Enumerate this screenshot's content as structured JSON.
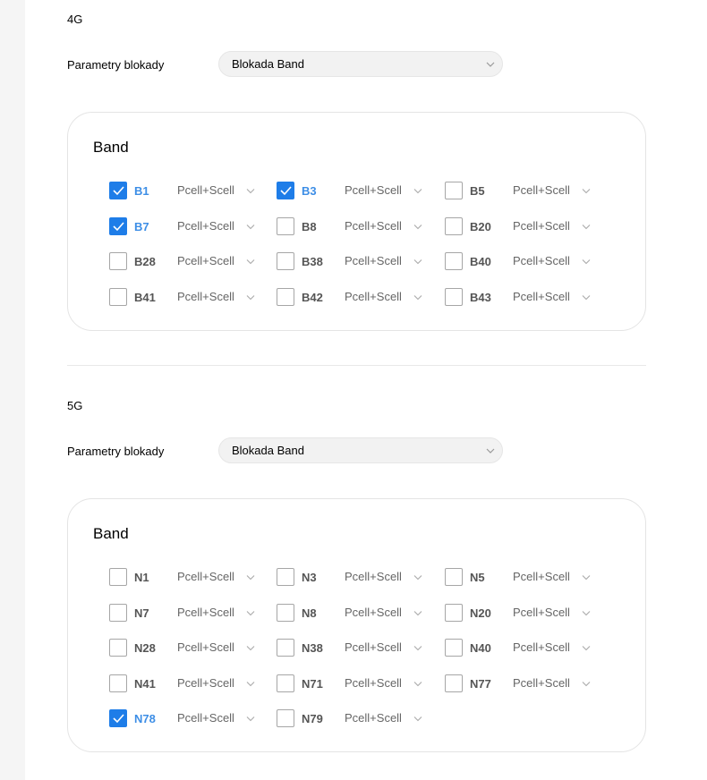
{
  "lte": {
    "section_label": "4G",
    "param_label": "Parametry blokady",
    "select_value": "Blokada Band",
    "card_title": "Band",
    "bands": [
      {
        "name": "B1",
        "mode": "Pcell+Scell",
        "checked": true
      },
      {
        "name": "B3",
        "mode": "Pcell+Scell",
        "checked": true
      },
      {
        "name": "B5",
        "mode": "Pcell+Scell",
        "checked": false
      },
      {
        "name": "B7",
        "mode": "Pcell+Scell",
        "checked": true
      },
      {
        "name": "B8",
        "mode": "Pcell+Scell",
        "checked": false
      },
      {
        "name": "B20",
        "mode": "Pcell+Scell",
        "checked": false
      },
      {
        "name": "B28",
        "mode": "Pcell+Scell",
        "checked": false
      },
      {
        "name": "B38",
        "mode": "Pcell+Scell",
        "checked": false
      },
      {
        "name": "B40",
        "mode": "Pcell+Scell",
        "checked": false
      },
      {
        "name": "B41",
        "mode": "Pcell+Scell",
        "checked": false
      },
      {
        "name": "B42",
        "mode": "Pcell+Scell",
        "checked": false
      },
      {
        "name": "B43",
        "mode": "Pcell+Scell",
        "checked": false
      }
    ]
  },
  "nr": {
    "section_label": "5G",
    "param_label": "Parametry blokady",
    "select_value": "Blokada Band",
    "card_title": "Band",
    "bands": [
      {
        "name": "N1",
        "mode": "Pcell+Scell",
        "checked": false
      },
      {
        "name": "N3",
        "mode": "Pcell+Scell",
        "checked": false
      },
      {
        "name": "N5",
        "mode": "Pcell+Scell",
        "checked": false
      },
      {
        "name": "N7",
        "mode": "Pcell+Scell",
        "checked": false
      },
      {
        "name": "N8",
        "mode": "Pcell+Scell",
        "checked": false
      },
      {
        "name": "N20",
        "mode": "Pcell+Scell",
        "checked": false
      },
      {
        "name": "N28",
        "mode": "Pcell+Scell",
        "checked": false
      },
      {
        "name": "N38",
        "mode": "Pcell+Scell",
        "checked": false
      },
      {
        "name": "N40",
        "mode": "Pcell+Scell",
        "checked": false
      },
      {
        "name": "N41",
        "mode": "Pcell+Scell",
        "checked": false
      },
      {
        "name": "N71",
        "mode": "Pcell+Scell",
        "checked": false
      },
      {
        "name": "N77",
        "mode": "Pcell+Scell",
        "checked": false
      },
      {
        "name": "N78",
        "mode": "Pcell+Scell",
        "checked": true
      },
      {
        "name": "N79",
        "mode": "Pcell+Scell",
        "checked": false
      }
    ]
  },
  "colors": {
    "accent": "#1e7de8",
    "checked_label": "#3d8ee6",
    "unchecked_label": "#555555",
    "sidebar_bg": "#f5f5f5"
  },
  "icons": {
    "select_chevron": "chevron-down-icon",
    "checkbox_mark": "check-icon"
  }
}
